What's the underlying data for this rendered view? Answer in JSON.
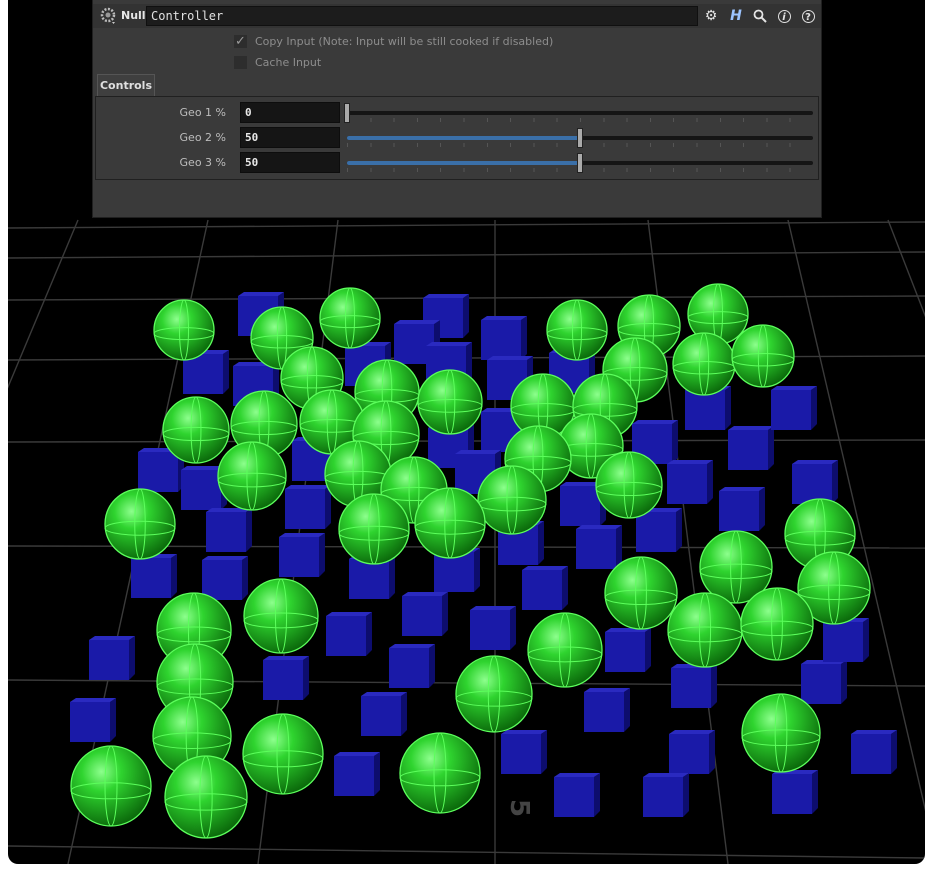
{
  "node": {
    "type_label": "Null",
    "name": "Controller",
    "icons": [
      "gear-icon",
      "houdini-help-icon",
      "search-icon",
      "info-icon",
      "help-icon"
    ]
  },
  "options": {
    "copy_input": {
      "label": "Copy Input (Note: Input will be still cooked if disabled)",
      "checked": true
    },
    "cache_input": {
      "label": "Cache Input",
      "checked": false
    }
  },
  "tabs": [
    {
      "label": "Controls",
      "active": true
    }
  ],
  "params": [
    {
      "label": "Geo 1 %",
      "value": "0",
      "fraction": 0.0
    },
    {
      "label": "Geo 2 %",
      "value": "50",
      "fraction": 0.5
    },
    {
      "label": "Geo 3 %",
      "value": "50",
      "fraction": 0.5
    }
  ],
  "viewport": {
    "grid_label": "5",
    "colors": {
      "background": "#000000",
      "grid": "#3a3a3a",
      "sphere": "#1ec81e",
      "sphere_wire": "#5cff5c",
      "cube": "#1a1aa8"
    }
  }
}
